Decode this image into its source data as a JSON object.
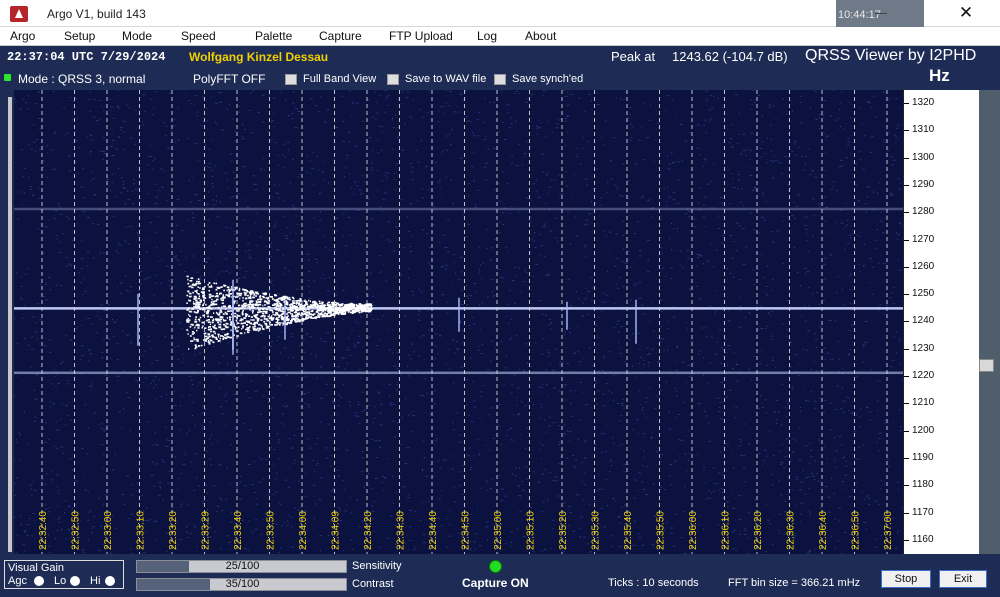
{
  "window": {
    "title": "Argo V1, build 143",
    "background_clock": "10:44:17",
    "close_glyph": "✕"
  },
  "menu": [
    {
      "label": "Argo"
    },
    {
      "label": "Setup"
    },
    {
      "label": "Mode"
    },
    {
      "label": "Speed"
    },
    {
      "label": "Palette"
    },
    {
      "label": "Capture"
    },
    {
      "label": "FTP Upload"
    },
    {
      "label": "Log"
    },
    {
      "label": "About"
    }
  ],
  "info": {
    "utc": "22:37:04 UTC  7/29/2024",
    "station": "Wolfgang Kinzel Dessau",
    "peak_label": "Peak at",
    "peak_value": "1243.62 (-104.7 dB)",
    "viewer_title": "QRSS Viewer by I2PHD",
    "units": "Hz",
    "mode": "Mode : QRSS 3, normal",
    "polyfft": "PolyFFT OFF",
    "checkboxes": [
      {
        "label": "Full Band View",
        "checked": false
      },
      {
        "label": "Save to WAV file",
        "checked": false
      },
      {
        "label": "Save synch'ed",
        "checked": false
      }
    ]
  },
  "frequency_scale": {
    "unit": "Hz",
    "labels": [
      "1320",
      "1310",
      "1300",
      "1290",
      "1280",
      "1270",
      "1260",
      "1250",
      "1240",
      "1230",
      "1220",
      "1210",
      "1200",
      "1190",
      "1180",
      "1170",
      "1160"
    ]
  },
  "spectrogram": {
    "colors": {
      "background": "#0b1240",
      "gridline": "#dcdcdc",
      "time_label": "#f0d000",
      "signal": "#ffffff"
    },
    "carrier_frequencies_hz": [
      1243.6,
      1220,
      1280
    ],
    "time_labels": [
      "22:32:40",
      "22:32:50",
      "22:33:00",
      "22:33:10",
      "22:33:20",
      "22:33:29",
      "22:33:40",
      "22:33:50",
      "22:34:00",
      "22:34:09",
      "22:34:20",
      "22:34:30",
      "22:34:40",
      "22:34:50",
      "22:35:00",
      "22:35:10",
      "22:35:20",
      "22:35:30",
      "22:35:40",
      "22:35:50",
      "22:36:00",
      "22:36:10",
      "22:36:20",
      "22:36:30",
      "22:36:40",
      "22:36:50",
      "22:37:00"
    ]
  },
  "controls": {
    "visual_gain_title": "Visual Gain",
    "gain_options": [
      {
        "label": "Agc",
        "selected": false
      },
      {
        "label": "Lo",
        "selected": false
      },
      {
        "label": "Hi",
        "selected": false
      }
    ],
    "sensitivity": {
      "value_text": "25/100",
      "value": 25,
      "label": "Sensitivity"
    },
    "contrast": {
      "value_text": "35/100",
      "value": 35,
      "label": "Contrast"
    },
    "capture_status": "Capture ON",
    "ticks": "Ticks  : 10 seconds",
    "fft_bin_size": "FFT bin size = 366.21 mHz",
    "stop_label": "Stop",
    "exit_label": "Exit"
  }
}
